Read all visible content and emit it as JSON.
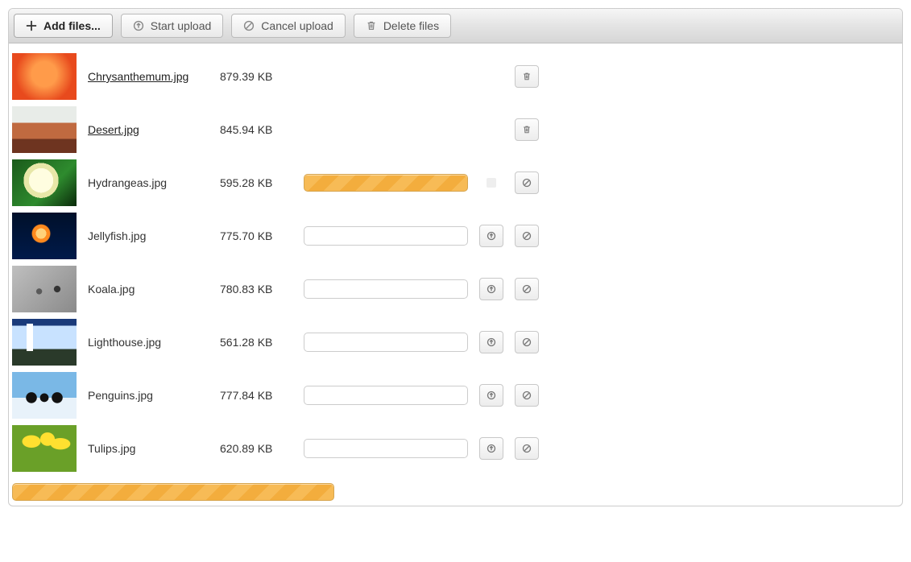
{
  "toolbar": {
    "add_files": "Add files...",
    "start_upload": "Start upload",
    "cancel_upload": "Cancel upload",
    "delete_files": "Delete files"
  },
  "files": [
    {
      "name": "Chrysanthemum.jpg",
      "size": "879.39 KB",
      "status": "done",
      "thumb": "orange-flower"
    },
    {
      "name": "Desert.jpg",
      "size": "845.94 KB",
      "status": "done",
      "thumb": "desert"
    },
    {
      "name": "Hydrangeas.jpg",
      "size": "595.28 KB",
      "status": "uploading",
      "thumb": "hydrangea"
    },
    {
      "name": "Jellyfish.jpg",
      "size": "775.70 KB",
      "status": "queued",
      "thumb": "jellyfish"
    },
    {
      "name": "Koala.jpg",
      "size": "780.83 KB",
      "status": "queued",
      "thumb": "koala"
    },
    {
      "name": "Lighthouse.jpg",
      "size": "561.28 KB",
      "status": "queued",
      "thumb": "lighthouse"
    },
    {
      "name": "Penguins.jpg",
      "size": "777.84 KB",
      "status": "queued",
      "thumb": "penguins"
    },
    {
      "name": "Tulips.jpg",
      "size": "620.89 KB",
      "status": "queued",
      "thumb": "tulips"
    }
  ],
  "icons": {
    "plus": "plus-icon",
    "upload": "upload-circle-icon",
    "cancel": "cancel-circle-icon",
    "trash": "trash-icon"
  }
}
